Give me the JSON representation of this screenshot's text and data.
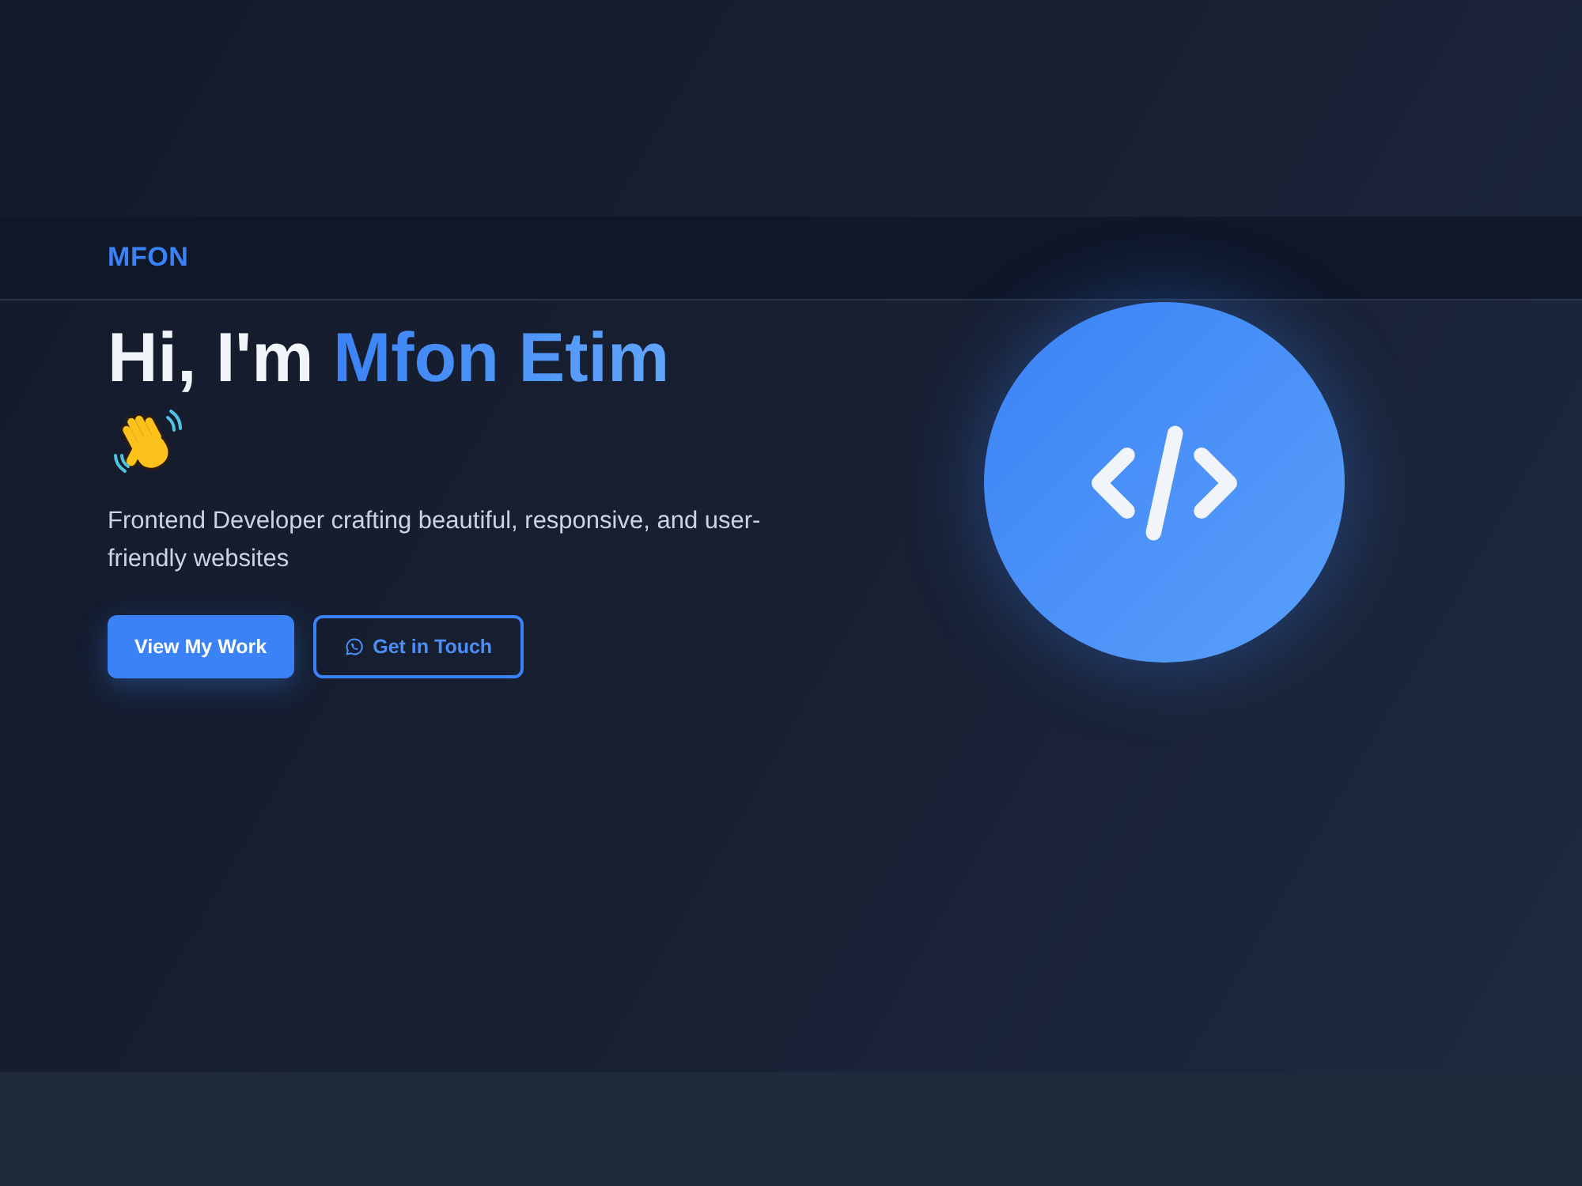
{
  "nav": {
    "logo": "MFON"
  },
  "hero": {
    "greeting": "Hi, I'm",
    "name": "Mfon Etim",
    "tagline": "Frontend Developer crafting beautiful, responsive, and user-friendly websites",
    "buttons": [
      {
        "label": "View My Work",
        "kind": "primary"
      },
      {
        "label": "Get in Touch",
        "kind": "outline"
      }
    ]
  }
}
